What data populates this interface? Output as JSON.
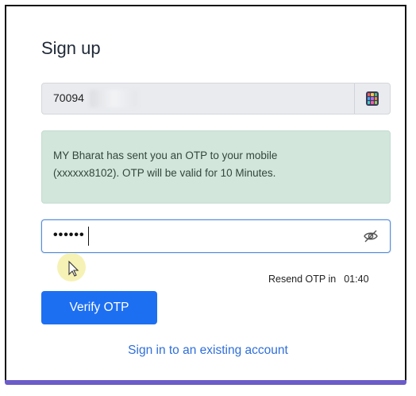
{
  "form": {
    "title": "Sign up",
    "phone": {
      "value": "70094",
      "icon": "phone-app-icon"
    },
    "otp_notice": {
      "line1": "MY Bharat has sent you an OTP to your mobile",
      "line2": "(xxxxxx8102). OTP will be valid for 10 Minutes."
    },
    "otp_input": {
      "value": "••••••",
      "toggle_icon": "eye-slash-icon"
    },
    "resend": {
      "label": "Resend OTP in",
      "timer": "01:40"
    },
    "verify_button": "Verify OTP",
    "signin_link": "Sign in to an existing account"
  },
  "colors": {
    "primary": "#1d6ff2",
    "link": "#2f6fd9",
    "notice_bg": "#d2e6dc",
    "field_bg": "#e9ebef",
    "accent_bar": "#6b5cc8"
  }
}
